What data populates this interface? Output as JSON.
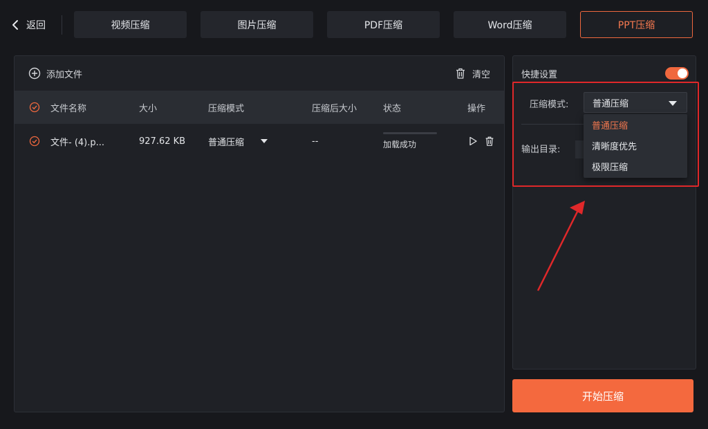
{
  "nav": {
    "back_label": "返回",
    "tabs": [
      {
        "label": "视频压缩"
      },
      {
        "label": "图片压缩"
      },
      {
        "label": "PDF压缩"
      },
      {
        "label": "Word压缩"
      },
      {
        "label": "PPT压缩",
        "active": true
      }
    ]
  },
  "file_panel": {
    "add_label": "添加文件",
    "clear_label": "清空",
    "columns": [
      "文件名称",
      "大小",
      "压缩模式",
      "压缩后大小",
      "状态",
      "操作"
    ],
    "rows": [
      {
        "name": "文件- (4).p...",
        "size": "927.62 KB",
        "mode": "普通压缩",
        "compressed_size": "--",
        "status": "加载成功"
      }
    ]
  },
  "settings": {
    "quick_label": "快捷设置",
    "quick_enabled": true,
    "mode_label": "压缩模式:",
    "mode_value": "普通压缩",
    "output_label": "输出目录:",
    "mode_options": [
      "普通压缩",
      "清晰度优先",
      "极限压缩"
    ]
  },
  "start_label": "开始压缩",
  "colors": {
    "accent": "#f4693e",
    "highlight": "#e0282a"
  }
}
